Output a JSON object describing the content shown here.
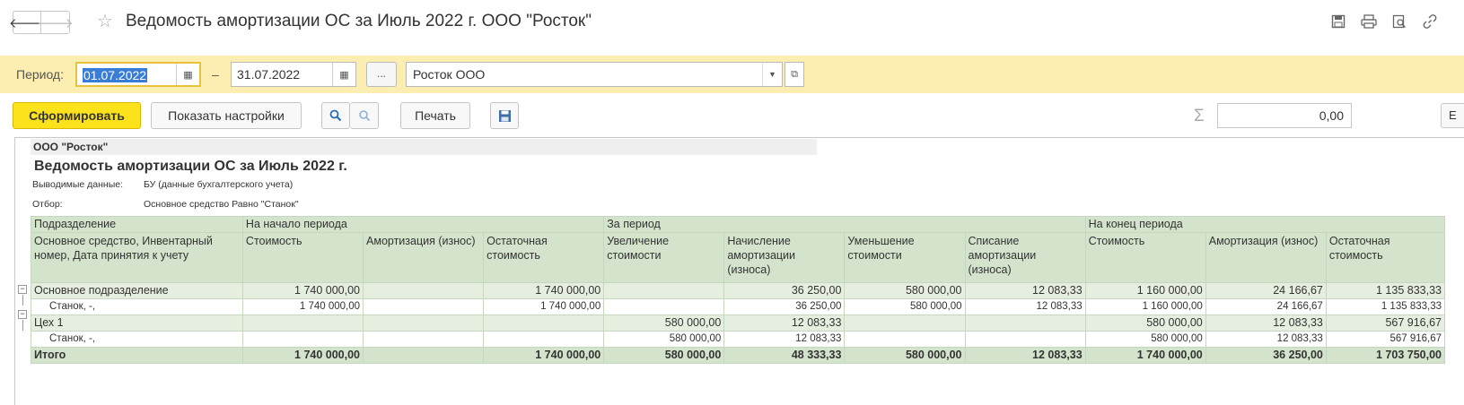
{
  "window": {
    "title": "Ведомость амортизации ОС за Июль 2022 г. ООО \"Росток\"",
    "back_icon": "arrow-left-icon",
    "forward_icon": "arrow-right-icon"
  },
  "period": {
    "label": "Период:",
    "from": "01.07.2022",
    "separator": "–",
    "to": "31.07.2022",
    "more_label": "...",
    "organization": "Росток ООО"
  },
  "toolbar": {
    "generate_label": "Сформировать",
    "settings_label": "Показать настройки",
    "print_label": "Печать",
    "sum_value": "0,00",
    "more_label": "Е"
  },
  "report": {
    "org": "ООО \"Росток\"",
    "title": "Ведомость амортизации ОС за Июль 2022 г.",
    "output_label": "Выводимые данные:",
    "output_value": "БУ (данные бухгалтерского учета)",
    "filter_label": "Отбор:",
    "filter_value": "Основное средство Равно \"Станок\""
  },
  "table": {
    "group_headers": [
      "Подразделение",
      "На начало периода",
      "За период",
      "На конец периода"
    ],
    "columns": [
      "Основное средство, Инвентарный номер, Дата принятия к учету",
      "Стоимость",
      "Амортизация (износ)",
      "Остаточная стоимость",
      "Увеличение стоимости",
      "Начисление амортизации (износа)",
      "Уменьшение стоимости",
      "Списание амортизации (износа)",
      "Стоимость",
      "Амортизация (износ)",
      "Остаточная стоимость"
    ],
    "rows": [
      [
        "Основное подразделение",
        "1 740 000,00",
        "",
        "1 740 000,00",
        "",
        "36 250,00",
        "580 000,00",
        "12 083,33",
        "1 160 000,00",
        "24 166,67",
        "1 135 833,33"
      ],
      [
        "Станок, -,",
        "1 740 000,00",
        "",
        "1 740 000,00",
        "",
        "36 250,00",
        "580 000,00",
        "12 083,33",
        "1 160 000,00",
        "24 166,67",
        "1 135 833,33"
      ],
      [
        "Цех 1",
        "",
        "",
        "",
        "580 000,00",
        "12 083,33",
        "",
        "",
        "580 000,00",
        "12 083,33",
        "567 916,67"
      ],
      [
        "Станок, -,",
        "",
        "",
        "",
        "580 000,00",
        "12 083,33",
        "",
        "",
        "580 000,00",
        "12 083,33",
        "567 916,67"
      ],
      [
        "Итого",
        "1 740 000,00",
        "",
        "1 740 000,00",
        "580 000,00",
        "48 333,33",
        "580 000,00",
        "12 083,33",
        "1 740 000,00",
        "36 250,00",
        "1 703 750,00"
      ]
    ]
  }
}
